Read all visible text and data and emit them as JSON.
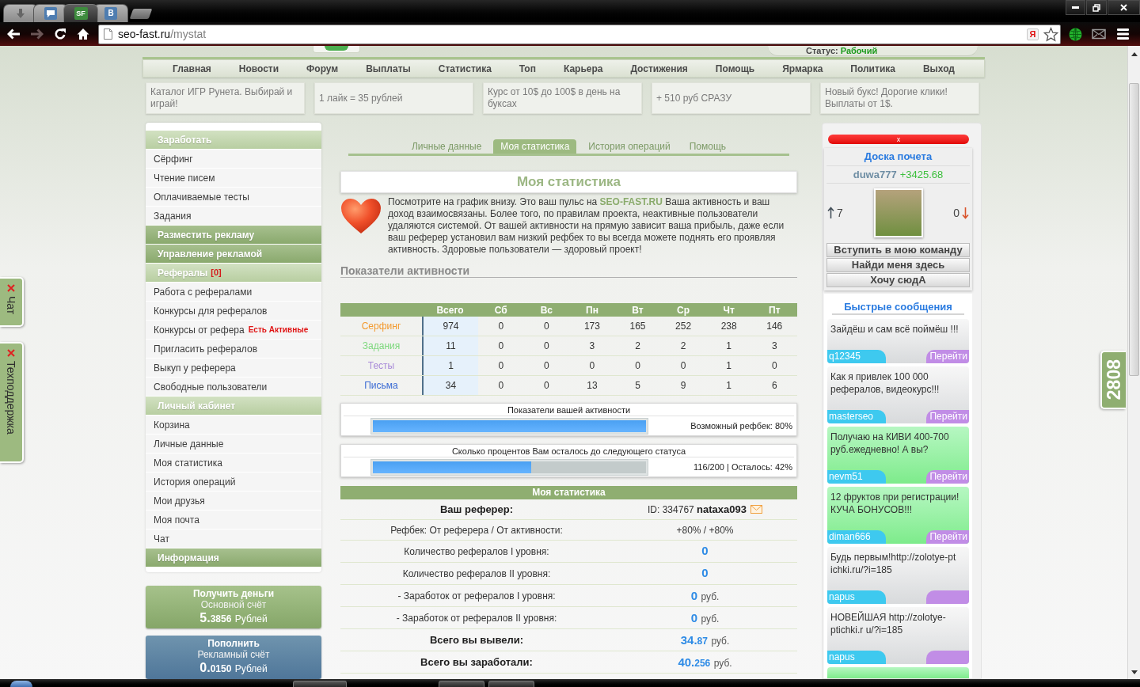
{
  "browser": {
    "tabs": [
      {
        "kind": "download",
        "selected": false
      },
      {
        "kind": "chat",
        "selected": false
      },
      {
        "kind": "site",
        "icon_text": "SF",
        "selected": true
      },
      {
        "kind": "social",
        "icon_text": "B",
        "selected": false
      }
    ],
    "forward_disabled": true,
    "url": {
      "host": "seo-fast.ru",
      "path": "/mystat"
    },
    "extension_badge": "Я"
  },
  "header": {
    "status_label": "Статус:",
    "status_value": "Рабочий"
  },
  "nav": [
    "Главная",
    "Новости",
    "Форум",
    "Выплаты",
    "Статистика",
    "Топ",
    "Карьера",
    "Достижения",
    "Помощь",
    "Ярмарка",
    "Политика",
    "Выход"
  ],
  "ads": [
    "Каталог ИГР Рунета. Выбирай и играй!",
    "1 лайк = 35 рублей",
    "Курс от 10$ до 100$ в день на буксах",
    "+ 510 руб СРАЗУ",
    "Новый букс! Дорогие клики! Выплаты от 1$."
  ],
  "sidebar": {
    "sections": [
      {
        "title": "Заработать",
        "expanded": true,
        "children": [
          {
            "label": "Сёрфинг"
          },
          {
            "label": "Чтение писем"
          },
          {
            "label": "Оплачиваемые тесты"
          },
          {
            "label": "Задания"
          }
        ]
      },
      {
        "title": "Разместить рекламу",
        "expanded": false
      },
      {
        "title": "Управление рекламой",
        "expanded": false
      },
      {
        "title": "Рефералы",
        "badge": "[0]",
        "expanded": true,
        "children": [
          {
            "label": "Работа с рефералами"
          },
          {
            "label": "Конкурсы для рефералов"
          },
          {
            "label": "Конкурсы от рефера",
            "badge": "Есть Активные"
          },
          {
            "label": "Пригласить рефералов"
          },
          {
            "label": "Выкуп у реферера"
          },
          {
            "label": "Свободные пользователи"
          }
        ]
      },
      {
        "title": "Личный кабинет",
        "expanded": true,
        "children": [
          {
            "label": "Корзина"
          },
          {
            "label": "Личные данные"
          },
          {
            "label": "Моя статистика"
          },
          {
            "label": "История операций"
          },
          {
            "label": "Мои друзья"
          },
          {
            "label": "Моя почта"
          },
          {
            "label": "Чат"
          }
        ]
      },
      {
        "title": "Информация",
        "expanded": false
      }
    ]
  },
  "balances": [
    {
      "kind": "withdraw",
      "title": "Получить деньги",
      "account": "Основной счёт",
      "amount_major": "5.",
      "amount_minor": "3856",
      "currency": "Рублей"
    },
    {
      "kind": "topup",
      "title": "Пополнить",
      "account": "Рекламный счёт",
      "amount_major": "0.",
      "amount_minor": "0150",
      "currency": "Рублей"
    }
  ],
  "side_tabs": [
    {
      "label": "Чат"
    },
    {
      "label": "Техподдержка"
    }
  ],
  "counter": "2808",
  "content": {
    "tabs": [
      {
        "label": "Личные данные",
        "selected": false
      },
      {
        "label": "Моя статистика",
        "selected": true
      },
      {
        "label": "История операций",
        "selected": false
      },
      {
        "label": "Помощь",
        "selected": false
      }
    ],
    "title": "Моя статистика",
    "intro": "Посмотрите на график внизу. Это ваш пульс на **SEO-FAST.RU** Ваша активность и ваш доход взаимосвязаны. Более того, по правилам проекта, неактивные пользователи удаляются системой. От вашей активности на прямую зависит ваша прибыль, даже если ваш реферер установил вам низкий рефбек то вы всегда можете поднять его проявляя активность. Здоровые пользователи — здоровый проект!",
    "section_title": "Показатели активности",
    "activity": {
      "columns": [
        "Всего",
        "Сб",
        "Вс",
        "Пн",
        "Вт",
        "Ср",
        "Чт",
        "Пт"
      ],
      "rows": [
        {
          "label": "Серфинг",
          "color": "#f39a2e",
          "cells": [
            "974",
            "0",
            "0",
            "173",
            "165",
            "252",
            "238",
            "146"
          ]
        },
        {
          "label": "Задания",
          "color": "#7dd87d",
          "cells": [
            "11",
            "0",
            "0",
            "3",
            "2",
            "2",
            "1",
            "3"
          ]
        },
        {
          "label": "Тесты",
          "color": "#a88ad8",
          "cells": [
            "1",
            "0",
            "0",
            "0",
            "0",
            "0",
            "1",
            "0"
          ]
        },
        {
          "label": "Письма",
          "color": "#3a6ad4",
          "cells": [
            "34",
            "0",
            "0",
            "13",
            "5",
            "9",
            "1",
            "6"
          ]
        }
      ]
    },
    "meters": [
      {
        "title": "Показатели вашей активности",
        "level": 1,
        "reading": "Возможный рефбек: 80%"
      },
      {
        "title": "Сколько процентов Вам осталось до следующего статуса",
        "level": 0.58,
        "reading": "116/200 | Осталось: 42%"
      }
    ],
    "stats": {
      "title": "Моя статистика",
      "rows": [
        {
          "kind": "referrer",
          "label": "Ваш реферер:",
          "value": "ID: 334767 **nataxa093**"
        },
        {
          "kind": "plain",
          "label": "Рефбек: От реферера / От активности:",
          "value": "+80% / +80%"
        },
        {
          "kind": "count",
          "label": "Количество рефералов I уровня:",
          "value": "0"
        },
        {
          "kind": "count",
          "label": "Количество рефералов II уровня:",
          "value": "0"
        },
        {
          "kind": "money",
          "label": "- Заработок от рефералов I уровня:",
          "major": "0",
          "unit": "руб."
        },
        {
          "kind": "money",
          "label": "- Заработок от рефералов II уровня:",
          "major": "0",
          "unit": "руб."
        },
        {
          "kind": "total",
          "label": "Всего вы вывели:",
          "major": "34.",
          "minor": "87",
          "unit": "руб."
        },
        {
          "kind": "total",
          "label": "Всего вы заработали:",
          "major": "40.",
          "minor": "256",
          "unit": "руб."
        }
      ]
    }
  },
  "right": {
    "close_label": "x",
    "honor": {
      "title": "Доска почета",
      "user": "duwa777",
      "score": "+3425.68",
      "up": "7",
      "down": "0",
      "buttons": [
        "Вступить в мою команду",
        "Найди меня здесь",
        "Хочу сюдА"
      ]
    },
    "messages": {
      "title": "Быстрые сообщения",
      "items": [
        {
          "text": "Зайдёш и сам всё поймёш !!!",
          "author": "q12345",
          "action": "Перейти",
          "highlighted": false
        },
        {
          "text": "Как я привлек 100 000 рефералов, видеокурс!!!",
          "author": "masterseo",
          "action": "Перейти",
          "highlighted": false
        },
        {
          "text": "Получаю на КИВИ 400-700 руб.ежедневно! А вы?",
          "author": "nevm51",
          "action": "Перейти",
          "highlighted": true
        },
        {
          "text": "12 фруктов при регистрации! КУЧА БОНУСОВ!!!",
          "author": "diman666",
          "action": "Перейти",
          "highlighted": true
        },
        {
          "text": "Будь первым!http://zolotye-pt ichki.ru/?i=185",
          "author": "napus",
          "highlighted": false
        },
        {
          "text": "НОВЕЙШАЯ http://zolotye-ptichki.r u/?i=185",
          "author": "napus",
          "highlighted": false
        },
        {
          "highlighted": true
        }
      ]
    }
  }
}
